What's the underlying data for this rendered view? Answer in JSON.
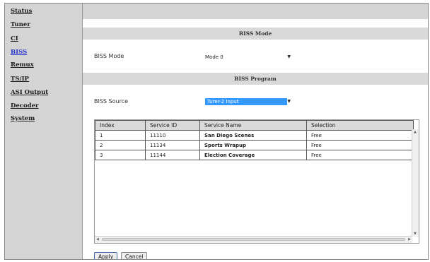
{
  "sidebar": {
    "items": [
      {
        "label": "Status",
        "active": false
      },
      {
        "label": "Tuner",
        "active": false
      },
      {
        "label": "CI",
        "active": false
      },
      {
        "label": "BISS",
        "active": true
      },
      {
        "label": "Remux",
        "active": false
      },
      {
        "label": "TS/IP",
        "active": false
      },
      {
        "label": "ASI Output",
        "active": false
      },
      {
        "label": "Decoder",
        "active": false
      },
      {
        "label": "System",
        "active": false
      }
    ]
  },
  "mode_section": {
    "title": "BISS Mode",
    "field_label": "BISS Mode",
    "selected_value": "Mode 0"
  },
  "program_section": {
    "title": "BISS Program",
    "field_label": "BISS Source",
    "selected_value": "Turer-2 Input"
  },
  "table": {
    "headers": [
      "Index",
      "Service ID",
      "Service Name",
      "Selection"
    ],
    "rows": [
      [
        "1",
        "11110",
        "San Diego Scenes",
        "Free"
      ],
      [
        "2",
        "11134",
        "Sports Wrapup",
        "Free"
      ],
      [
        "3",
        "11144",
        "Election Coverage",
        "Free"
      ]
    ]
  },
  "buttons": {
    "apply": "Apply",
    "cancel": "Cancel"
  },
  "icons": {
    "dropdown": "chevron-down-icon",
    "scroll_up": "arrow-up-icon",
    "scroll_down": "arrow-down-icon",
    "scroll_left": "arrow-left-icon",
    "scroll_right": "arrow-right-icon"
  },
  "colors": {
    "sidebar_bg": "#d4d4d4",
    "active_link": "#2233cc",
    "selection_highlight": "#3399ff"
  }
}
